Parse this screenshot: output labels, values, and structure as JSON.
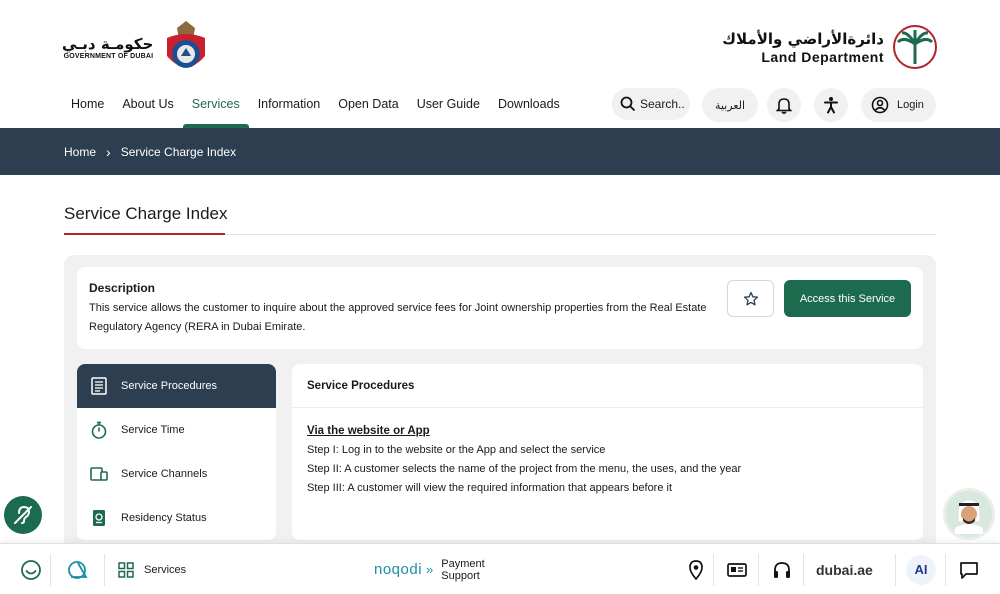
{
  "header": {
    "gov_arabic": "حكومـة دبـي",
    "gov_english": "GOVERNMENT OF DUBAI",
    "ld_arabic": "دائرةالأراضي والأملاك",
    "ld_english": "Land Department"
  },
  "nav": {
    "items": [
      "Home",
      "About Us",
      "Services",
      "Information",
      "Open Data",
      "User Guide",
      "Downloads"
    ],
    "active": "Services"
  },
  "utility": {
    "search_label": "Search..",
    "lang_label": "العربية",
    "login_label": "Login"
  },
  "breadcrumb": {
    "home": "Home",
    "current": "Service Charge Index"
  },
  "page": {
    "title": "Service Charge Index"
  },
  "description": {
    "title": "Description",
    "text": "This service allows the customer to inquire about the approved service fees for Joint ownership properties from the Real Estate Regulatory Agency (RERA in Dubai Emirate.",
    "access_button": "Access this Service"
  },
  "side_menu": {
    "items": [
      "Service Procedures",
      "Service Time",
      "Service Channels",
      "Residency Status"
    ],
    "active": "Service Procedures"
  },
  "content": {
    "heading": "Service Procedures",
    "subheading": "Via the website or App",
    "steps": [
      "Step I: Log in to the website or the App and select the service",
      "Step II: A customer selects the name of the project from the menu, the uses, and the year",
      "Step III: A customer will view the required information that appears before it"
    ]
  },
  "bottom_bar": {
    "services_label": "Services",
    "noqodi_label": "noqodi",
    "payment_line1": "Payment",
    "payment_line2": "Support",
    "dubaiae_label": "dubai.ae",
    "ai_label": "AI"
  },
  "colors": {
    "brand_green": "#1d6b4f",
    "navy": "#2c3e50",
    "accent_red": "#b3232d"
  }
}
